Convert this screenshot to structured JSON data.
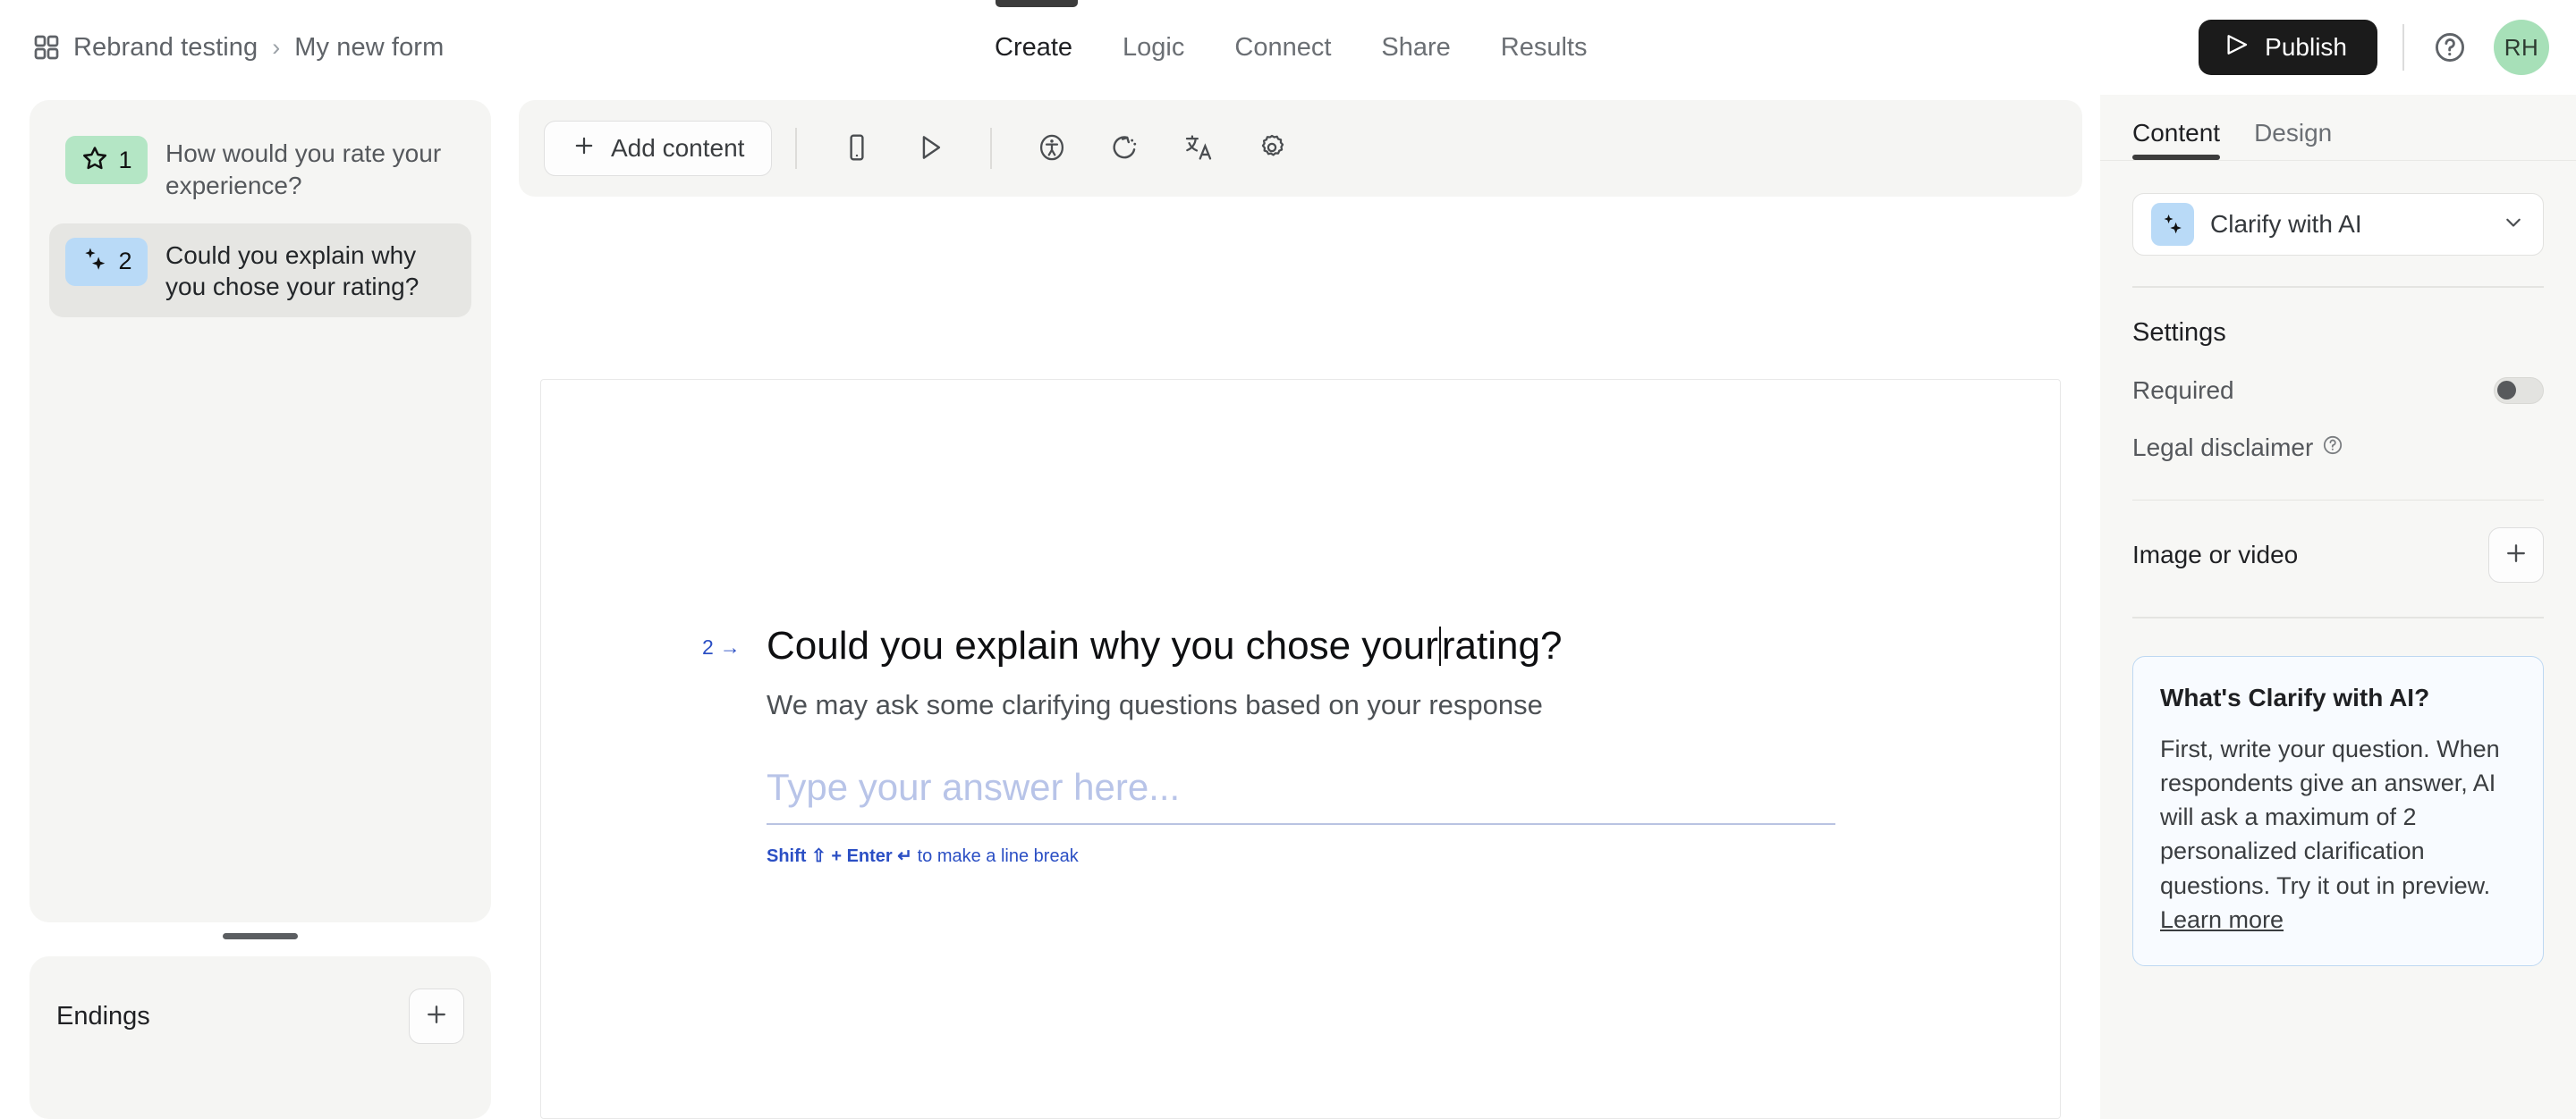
{
  "breadcrumb": {
    "icon": "grid-icon",
    "workspace": "Rebrand testing",
    "separator": "›",
    "form": "My new form"
  },
  "main_tabs": [
    {
      "label": "Create",
      "active": true
    },
    {
      "label": "Logic",
      "active": false
    },
    {
      "label": "Connect",
      "active": false
    },
    {
      "label": "Share",
      "active": false
    },
    {
      "label": "Results",
      "active": false
    }
  ],
  "topright": {
    "publish_label": "Publish",
    "publish_icon": "send-icon",
    "publish_bg": "#1b1b1b",
    "help_icon": "help-circle-icon",
    "avatar_initials": "RH",
    "avatar_bg": "#a7e0b8"
  },
  "sidebar": {
    "questions": [
      {
        "number": "1",
        "label": "How would you rate your experience?",
        "icon": "star-icon",
        "badge_color": "#b4e6c5",
        "selected": false
      },
      {
        "number": "2",
        "label": "Could you explain why you chose your rating?",
        "icon": "sparkle-icon",
        "badge_color": "#b9daf7",
        "selected": true
      }
    ],
    "endings": {
      "title": "Endings",
      "add_icon": "plus-icon"
    }
  },
  "toolbar": {
    "add_content_label": "Add content",
    "add_content_icon": "plus-icon",
    "buttons": [
      {
        "icon": "mobile-device-icon",
        "name": "device-preview-button"
      },
      {
        "icon": "play-icon",
        "name": "preview-button"
      },
      {
        "icon": "accessibility-icon",
        "name": "accessibility-button"
      },
      {
        "icon": "reset-icon",
        "name": "reset-button"
      },
      {
        "icon": "translate-icon",
        "name": "translate-button"
      },
      {
        "icon": "gear-icon",
        "name": "settings-button"
      }
    ]
  },
  "canvas": {
    "question_marker": "2",
    "marker_arrow": "→",
    "question_text_before_caret": "Could you explain why you chose your",
    "question_text_after_caret": "rating?",
    "description": "We may ask some clarifying questions based on your response",
    "answer_placeholder": "Type your answer here...",
    "hint_bold_1": "Shift",
    "hint_glyph_1": "⇧",
    "hint_plus": "+",
    "hint_bold_2": "Enter",
    "hint_glyph_2": "↵",
    "hint_rest": "to make a line break",
    "hint_color": "#2b4fc4"
  },
  "right_panel": {
    "tabs": [
      {
        "label": "Content",
        "active": true
      },
      {
        "label": "Design",
        "active": false
      }
    ],
    "question_type": {
      "label": "Clarify with AI",
      "icon": "sparkle-icon",
      "icon_bg": "#b9daf7",
      "chevron": "chevron-down-icon"
    },
    "settings_title": "Settings",
    "required": {
      "label": "Required",
      "enabled": false
    },
    "legal_disclaimer": {
      "label": "Legal disclaimer",
      "info_icon": "help-circle-icon"
    },
    "image_or_video": {
      "label": "Image or video",
      "add_icon": "plus-icon"
    },
    "info_card": {
      "title": "What's Clarify with AI?",
      "body": "First, write your question. When respondents give an answer, AI will ask a maximum of 2 personalized clarification questions. Try it out in preview. ",
      "link": "Learn more",
      "border_color": "#bed8f2",
      "bg_color": "#f8fbff"
    }
  }
}
